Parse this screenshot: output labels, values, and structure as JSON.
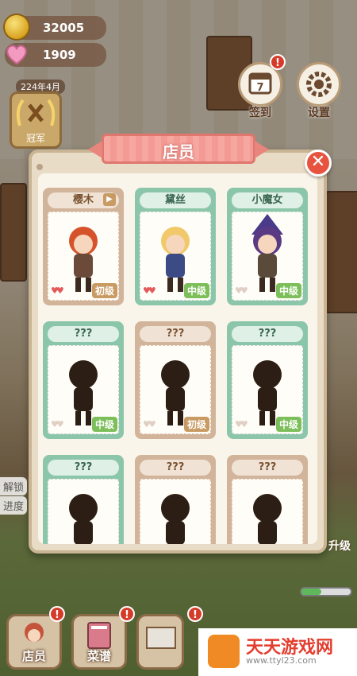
{
  "resources": {
    "coins": "32005",
    "hearts": "1909"
  },
  "date": "224年4月",
  "trophy_label": "冠军",
  "top_buttons": [
    {
      "label": "签到",
      "icon": "calendar-icon",
      "day": "7"
    },
    {
      "label": "设置",
      "icon": "gear-icon"
    }
  ],
  "modal": {
    "title": "店员",
    "close": "✕",
    "cards": [
      {
        "name": "樱木",
        "level": "初级",
        "theme": "tan",
        "hearts": 2,
        "has_film": true,
        "locked": false
      },
      {
        "name": "黛丝",
        "level": "中级",
        "theme": "green",
        "hearts": 2,
        "has_film": false,
        "locked": false
      },
      {
        "name": "小魔女",
        "level": "中级",
        "theme": "green",
        "hearts": 0,
        "has_film": false,
        "locked": false
      },
      {
        "name": "???",
        "level": "中级",
        "theme": "green",
        "hearts": 0,
        "has_film": false,
        "locked": true
      },
      {
        "name": "???",
        "level": "初级",
        "theme": "tan",
        "hearts": 0,
        "has_film": false,
        "locked": true
      },
      {
        "name": "???",
        "level": "中级",
        "theme": "green",
        "hearts": 0,
        "has_film": false,
        "locked": true
      },
      {
        "name": "???",
        "level": "",
        "theme": "green",
        "hearts": 0,
        "has_film": false,
        "locked": true
      },
      {
        "name": "???",
        "level": "",
        "theme": "tan",
        "hearts": 0,
        "has_film": false,
        "locked": true
      },
      {
        "name": "???",
        "level": "",
        "theme": "tan",
        "hearts": 0,
        "has_film": false,
        "locked": true
      }
    ]
  },
  "side_labels": {
    "unlock": "解锁",
    "progress": "进度",
    "upgrade": "升级"
  },
  "bottom_nav": [
    {
      "label": "店员"
    },
    {
      "label": "菜谱"
    }
  ],
  "watermark": {
    "title": "天天游戏网",
    "url": "www.ttyl23.com"
  },
  "colors": {
    "green_card": "#8cc6aa",
    "tan_card": "#d2b49b",
    "banner": "#f6a7a0",
    "close": "#e8533f"
  }
}
